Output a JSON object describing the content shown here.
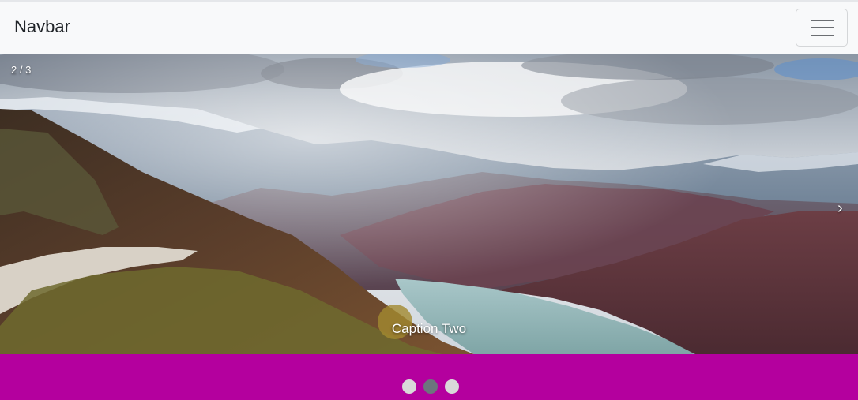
{
  "navbar": {
    "brand": "Navbar",
    "toggler_icon": "hamburger-icon"
  },
  "carousel": {
    "counter": "2 / 3",
    "caption": "Caption Two",
    "next_icon": "chevron-right-icon",
    "next_glyph": "›",
    "active_index": 2,
    "total": 3
  },
  "indicators": {
    "count": 3,
    "active": 2,
    "active_color": "#6c757d",
    "inactive_color": "#d9d9d9"
  },
  "colors": {
    "navbar_bg": "#f8f9fa",
    "band_bg": "#b4009e"
  }
}
